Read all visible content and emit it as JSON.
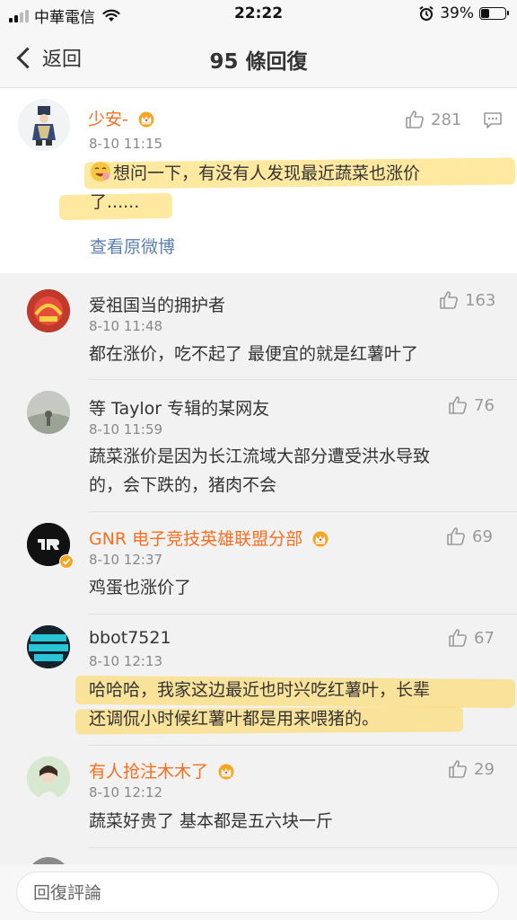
{
  "status_bar": {
    "carrier": "中華電信",
    "time": "22:22",
    "battery_percent": "39%",
    "battery_level": 0.39
  },
  "nav": {
    "back_label": "返回",
    "title": "95 條回復"
  },
  "original_post": {
    "username": "少安-",
    "timestamp": "8-10 11:15",
    "likes": "281",
    "text_line1": "想问一下，有没有人发现最近蔬菜也涨价",
    "text_line2": "了......",
    "view_original_label": "查看原微博",
    "emoji_icon": "smiling-face-emoji-icon"
  },
  "comments": [
    {
      "username": "爱祖国当的拥护者",
      "timestamp": "8-10 11:48",
      "likes": "163",
      "lines": [
        "都在涨价，吃不起了 最便宜的就是红薯叶了"
      ],
      "vip": false,
      "username_color": "#333333"
    },
    {
      "username": "等 Taylor 专辑的某网友",
      "timestamp": "8-10 11:59",
      "likes": "76",
      "lines": [
        "蔬菜涨价是因为长江流域大部分遭受洪水导致",
        "的，会下跌的，猪肉不会"
      ],
      "vip": false,
      "username_color": "#333333"
    },
    {
      "username": "GNR 电子竞技英雄联盟分部",
      "timestamp": "8-10 12:37",
      "likes": "69",
      "lines": [
        "鸡蛋也涨价了"
      ],
      "vip": true,
      "username_color": "#f86e1f"
    },
    {
      "username": "bbot7521",
      "timestamp": "8-10 12:13",
      "likes": "67",
      "lines": [
        "哈哈哈，我家这边最近也时兴吃红薯叶，长辈",
        "还调侃小时候红薯叶都是用来喂猪的。"
      ],
      "vip": false,
      "username_color": "#333333"
    },
    {
      "username": "有人抢注木木了",
      "timestamp": "8-10 12:12",
      "likes": "29",
      "lines": [
        "蔬菜好贵了 基本都是五六块一斤"
      ],
      "vip": true,
      "username_color": "#f86e1f"
    }
  ],
  "reply_bar": {
    "placeholder": "回復評論"
  },
  "colors": {
    "accent_orange": "#f86e1f",
    "link_blue": "#5b7fb0",
    "highlight_yellow": "#ffd650",
    "vip_gold": "#f5a623"
  }
}
